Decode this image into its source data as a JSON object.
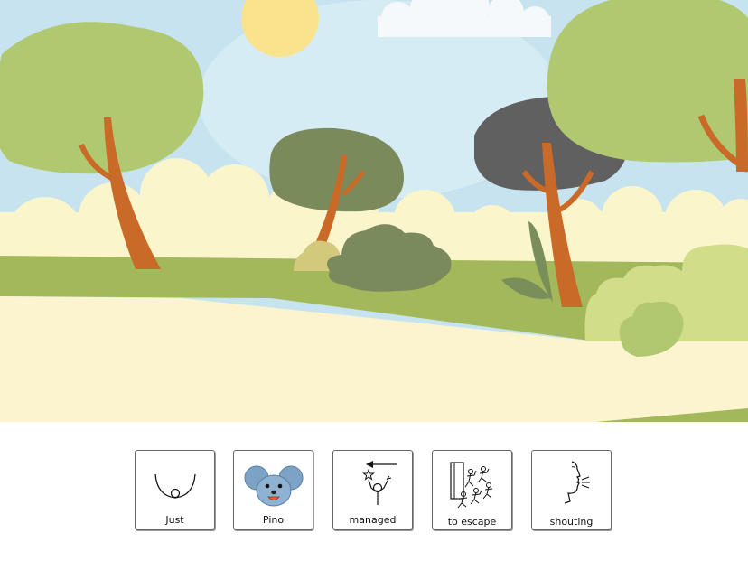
{
  "scene": {
    "name": "park-illustration",
    "colors": {
      "sky": "#c6e3ef",
      "sun": "#fbe28c",
      "tree_light": "#b0c970",
      "tree_olive": "#7a8a5a",
      "tree_dark": "#606060",
      "trunk": "#c96a28",
      "hills": "#fbf5cc",
      "grass": "#a2b85a",
      "path": "#fbf4cf"
    }
  },
  "cards": [
    {
      "label": "Just",
      "icon": "just-icon"
    },
    {
      "label": "Pino",
      "icon": "mouse-face-icon"
    },
    {
      "label": "managed",
      "icon": "managed-icon"
    },
    {
      "label": "to escape",
      "icon": "escape-icon"
    },
    {
      "label": "shouting",
      "icon": "shouting-icon"
    }
  ]
}
